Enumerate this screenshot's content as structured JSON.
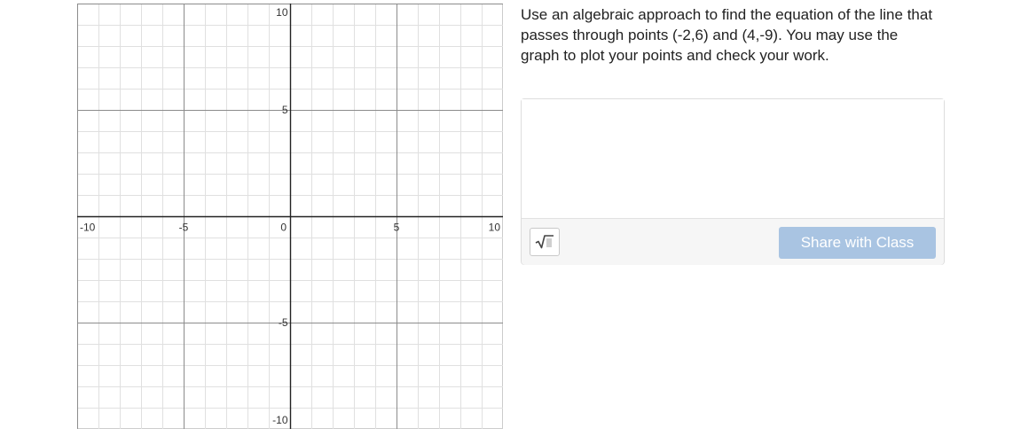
{
  "question": {
    "text": "Use an algebraic approach to find the equation of the line that passes through points (-2,6) and (4,-9).  You may use the graph to plot your points and check your work."
  },
  "response": {
    "math_icon": "square-root-icon",
    "share_label": "Share with Class"
  },
  "graph": {
    "xlim": [
      -10,
      10
    ],
    "ylim": [
      -10,
      10
    ],
    "grid_step": 1,
    "major_step": 5,
    "x_tick_labels": [
      "-10",
      "-5",
      "0",
      "5",
      "10"
    ],
    "y_tick_labels": [
      "10",
      "5",
      "-5",
      "-10"
    ]
  },
  "colors": {
    "share_button_bg": "#a9c4e2",
    "grid_minor": "#e0e0e0",
    "grid_major": "#8c8c8c",
    "axis": "#222222"
  }
}
